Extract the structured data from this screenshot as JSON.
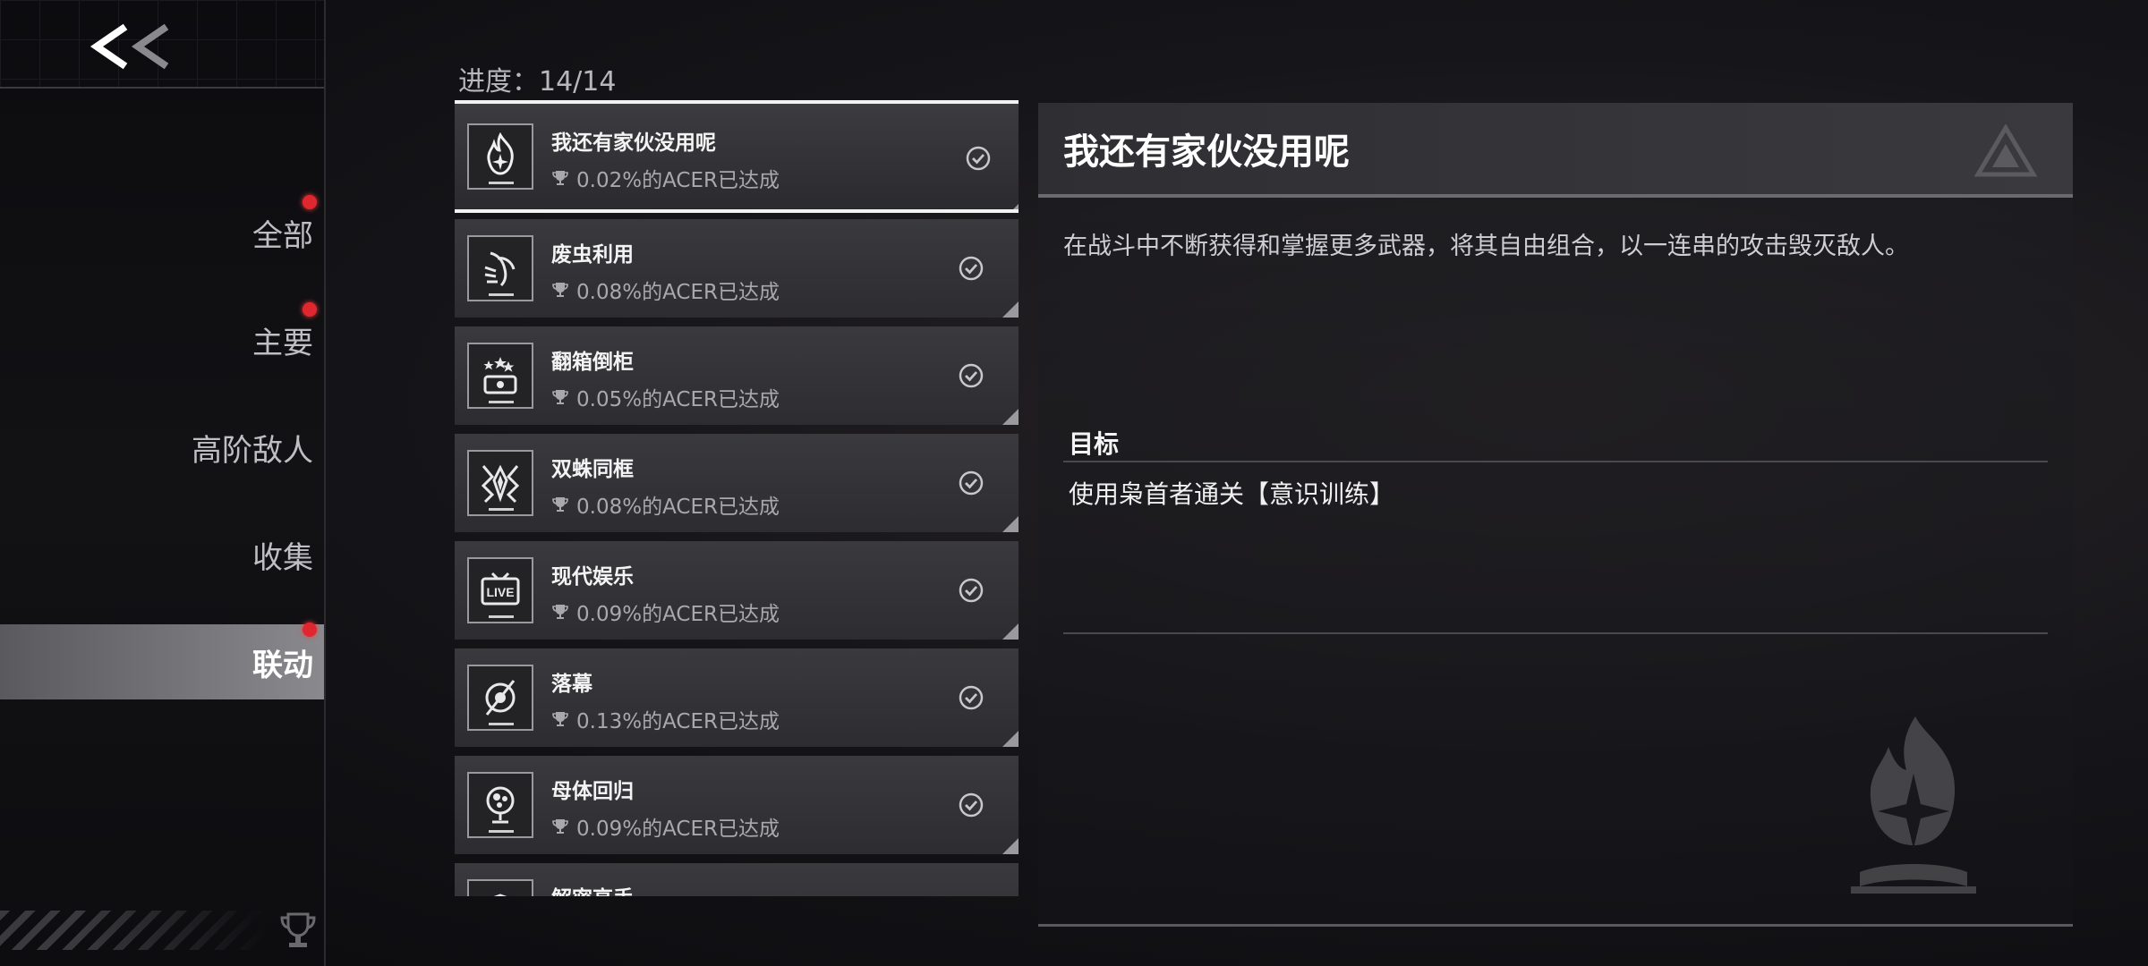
{
  "sidebar": {
    "back_label": "<<",
    "items": [
      {
        "label": "全部",
        "badge": true,
        "active": false
      },
      {
        "label": "主要",
        "badge": true,
        "active": false
      },
      {
        "label": "高阶敌人",
        "badge": false,
        "active": false
      },
      {
        "label": "收集",
        "badge": false,
        "active": false
      },
      {
        "label": "联动",
        "badge": true,
        "active": true
      }
    ]
  },
  "progress": "进度：14/14",
  "achievements": [
    {
      "title": "我还有家伙没用呢",
      "stat": "0.02%的ACER已达成",
      "icon": "flame-star-icon",
      "selected": true
    },
    {
      "title": "废虫利用",
      "stat": "0.08%的ACER已达成",
      "icon": "bug-claw-icon",
      "selected": false
    },
    {
      "title": "翻箱倒柜",
      "stat": "0.05%的ACER已达成",
      "icon": "treasure-chest-icon",
      "selected": false
    },
    {
      "title": "双蛛同框",
      "stat": "0.08%的ACER已达成",
      "icon": "spider-icon",
      "selected": false
    },
    {
      "title": "现代娱乐",
      "stat": "0.09%的ACER已达成",
      "icon": "live-tv-icon",
      "selected": false
    },
    {
      "title": "落幕",
      "stat": "0.13%的ACER已达成",
      "icon": "eye-slash-icon",
      "selected": false
    },
    {
      "title": "母体回归",
      "stat": "0.09%的ACER已达成",
      "icon": "orb-pedestal-icon",
      "selected": false
    },
    {
      "title": "解密高手",
      "stat": "",
      "icon": "shield-icon",
      "selected": false
    }
  ],
  "detail": {
    "title": "我还有家伙没用呢",
    "description": "在战斗中不断获得和掌握更多武器，将其自由组合，以一连串的攻击毁灭敌人。",
    "goal_label": "目标",
    "goal_text": "使用枭首者通关【意识训练】"
  },
  "colors": {
    "accent_red": "#e0262e",
    "selected_border": "#f2f2f2"
  }
}
